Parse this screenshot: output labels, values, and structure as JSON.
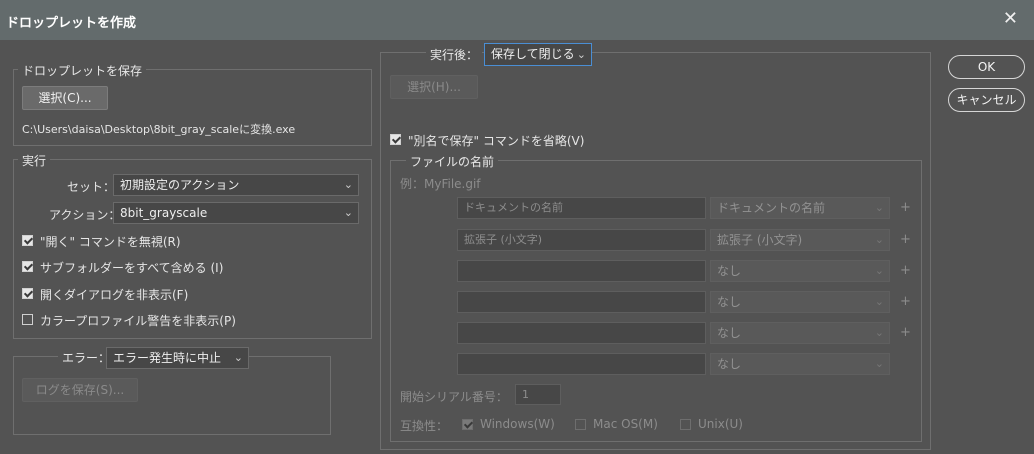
{
  "window": {
    "title": "ドロップレットを作成",
    "close_glyph": "✕"
  },
  "save": {
    "legend": "ドロップレットを保存",
    "select_button": "選択(C)...",
    "path": "C:\\Users\\daisa\\Desktop\\8bit_gray_scaleに変換.exe"
  },
  "play": {
    "legend": "実行",
    "set_label": "セット：",
    "set_value": "初期設定のアクション",
    "action_label": "アクション：",
    "action_value": "8bit_grayscale",
    "options": [
      {
        "label": "\"開く\" コマンドを無視(R)",
        "checked": true
      },
      {
        "label": "サブフォルダーをすべて含める (I)",
        "checked": true
      },
      {
        "label": "開くダイアログを非表示(F)",
        "checked": true
      },
      {
        "label": "カラープロファイル警告を非表示(P)",
        "checked": false
      }
    ]
  },
  "errors": {
    "label": "エラー：",
    "value": "エラー発生時に中止",
    "save_log_button": "ログを保存(S)..."
  },
  "destination": {
    "label": "実行後：",
    "value": "保存して閉じる",
    "choose_button": "選択(H)...",
    "override_label": "\"別名で保存\" コマンドを省略(V)",
    "override_checked": true
  },
  "naming": {
    "legend": "ファイルの名前",
    "example": "例：MyFile.gif",
    "rows": [
      {
        "text": "ドキュメントの名前",
        "select": "ドキュメントの名前",
        "plus": "+"
      },
      {
        "text": "拡張子 (小文字)",
        "select": "拡張子 (小文字)",
        "plus": "+"
      },
      {
        "text": "",
        "select": "なし",
        "plus": "+"
      },
      {
        "text": "",
        "select": "なし",
        "plus": "+"
      },
      {
        "text": "",
        "select": "なし",
        "plus": "+"
      },
      {
        "text": "",
        "select": "なし",
        "plus": ""
      }
    ],
    "serial_label": "開始シリアル番号：",
    "serial_value": "1",
    "compat_label": "互換性：",
    "compat": [
      {
        "label": "Windows(W)",
        "checked": true
      },
      {
        "label": "Mac OS(M)",
        "checked": false
      },
      {
        "label": "Unix(U)",
        "checked": false
      }
    ]
  },
  "buttons": {
    "ok": "OK",
    "cancel": "キャンセル"
  },
  "colors": {
    "dialog_bg": "#535353",
    "titlebar_bg": "#636b6c",
    "focus_ring": "#4a8ed4"
  }
}
